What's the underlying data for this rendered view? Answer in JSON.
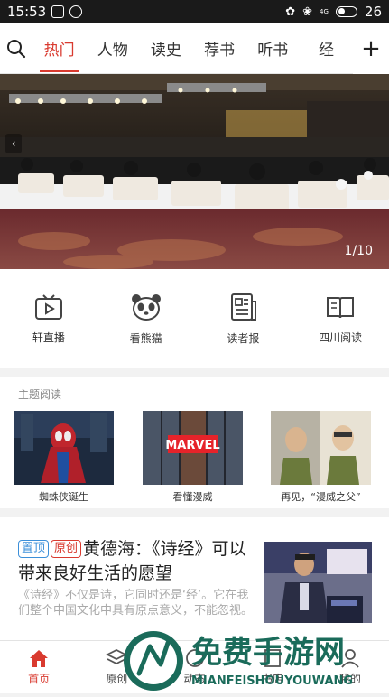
{
  "status_bar": {
    "time": "15:53",
    "network": "4G",
    "battery": "26"
  },
  "top_nav": {
    "tabs": [
      {
        "label": "热门",
        "active": true
      },
      {
        "label": "人物",
        "active": false
      },
      {
        "label": "读史",
        "active": false
      },
      {
        "label": "荐书",
        "active": false
      },
      {
        "label": "听书",
        "active": false
      },
      {
        "label": "经",
        "active": false
      }
    ]
  },
  "banner": {
    "counter": "1/10"
  },
  "quick_links": [
    {
      "label": "轩直播",
      "icon": "tv-play-icon"
    },
    {
      "label": "看熊猫",
      "icon": "panda-icon"
    },
    {
      "label": "读者报",
      "icon": "newspaper-icon"
    },
    {
      "label": "四川阅读",
      "icon": "open-book-icon"
    }
  ],
  "theme_reading": {
    "title": "主题阅读",
    "items": [
      {
        "caption": "蜘蛛侠诞生"
      },
      {
        "caption": "看懂漫威",
        "poster_text": "MARVEL"
      },
      {
        "caption": "再见，“漫威之父”"
      }
    ]
  },
  "article": {
    "tag_top": "置顶",
    "tag_original": "原创",
    "title": "黄德海：《诗经》可以带来良好生活的愿望",
    "summary": "《诗经》不仅是诗，它同时还是‘经’。它在我们整个中国文化中具有原点意义，不能忽视。"
  },
  "bottom_nav": [
    {
      "label": "首页",
      "active": true,
      "icon": "home-icon"
    },
    {
      "label": "原创",
      "active": false,
      "icon": "layers-icon"
    },
    {
      "label": "动态",
      "active": false,
      "icon": "activity-icon"
    },
    {
      "label": "书店",
      "active": false,
      "icon": "bookstore-icon"
    },
    {
      "label": "我的",
      "active": false,
      "icon": "profile-icon"
    }
  ],
  "watermark": {
    "title": "免费手游网",
    "subtitle": "MIANFEISHOUYOUWANG"
  },
  "colors": {
    "accent": "#d93a2f",
    "tag_blue": "#3b8fd9",
    "status_bar": "#1a1a1a"
  }
}
